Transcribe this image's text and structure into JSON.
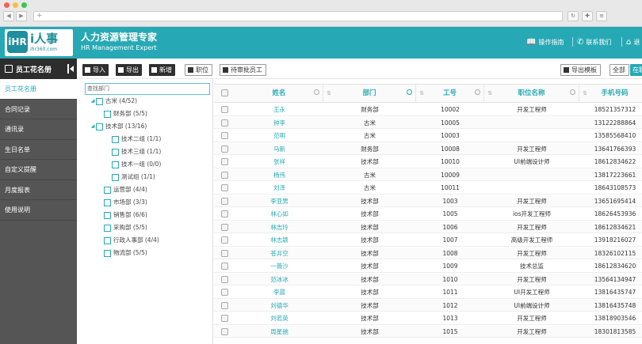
{
  "header": {
    "logo_text": "i人事",
    "logo_sub": "ihr360.com",
    "logo_mark": "iHR",
    "title": "人力资源管理专家",
    "subtitle": "HR Management Expert",
    "links": [
      "操作指南",
      "联系我们",
      "退"
    ]
  },
  "sidebar": {
    "title": "员工花名册",
    "items": [
      {
        "label": "员工花名册",
        "active": true
      },
      {
        "label": "合同记录",
        "active": false
      },
      {
        "label": "通讯录",
        "active": false
      },
      {
        "label": "生日名单",
        "active": false
      },
      {
        "label": "自定义提醒",
        "active": false
      },
      {
        "label": "月度报表",
        "active": false
      },
      {
        "label": "使用说明",
        "active": false
      }
    ]
  },
  "toolbar": {
    "import": "导入",
    "export": "导出",
    "add": "新增",
    "position": "职位",
    "pending": "待审批员工",
    "export_template": "导出模板",
    "all": "全部",
    "current": "在职"
  },
  "tree": {
    "search_placeholder": "查找部门",
    "nodes": [
      {
        "label": "古米 (4/52)",
        "toggle": "◢"
      },
      {
        "label": "财务部 (5/5)",
        "toggle": ""
      },
      {
        "label": "技术部 (13/16)",
        "toggle": "◢"
      },
      {
        "label": "技术二组 (1/1)",
        "toggle": ""
      },
      {
        "label": "技术三组 (1/1)",
        "toggle": ""
      },
      {
        "label": "技术一组 (0/0)",
        "toggle": ""
      },
      {
        "label": "测试组 (1/1)",
        "toggle": ""
      },
      {
        "label": "运营部 (4/4)",
        "toggle": ""
      },
      {
        "label": "市场部 (3/3)",
        "toggle": ""
      },
      {
        "label": "销售部 (6/6)",
        "toggle": ""
      },
      {
        "label": "采购部 (5/5)",
        "toggle": ""
      },
      {
        "label": "行政人事部 (4/4)",
        "toggle": ""
      },
      {
        "label": "物流部 (5/5)",
        "toggle": ""
      }
    ]
  },
  "grid": {
    "columns": [
      "姓名",
      "部门",
      "工号",
      "职位名称",
      "手机号码"
    ],
    "rows": [
      {
        "name": "王永",
        "dept": "财务部",
        "id": "10002",
        "title": "开发工程师",
        "phone": "18521357312"
      },
      {
        "name": "钟李",
        "dept": "古米",
        "id": "10005",
        "title": "",
        "phone": "13122288864"
      },
      {
        "name": "范明",
        "dept": "古米",
        "id": "10003",
        "title": "",
        "phone": "13585568410"
      },
      {
        "name": "马新",
        "dept": "财务部",
        "id": "10008",
        "title": "开发工程师",
        "phone": "13641766393"
      },
      {
        "name": "张祥",
        "dept": "技术部",
        "id": "10010",
        "title": "UI前端设计师",
        "phone": "18612834622"
      },
      {
        "name": "杨伟",
        "dept": "古米",
        "id": "10009",
        "title": "",
        "phone": "13817223661"
      },
      {
        "name": "刘泽",
        "dept": "古米",
        "id": "10011",
        "title": "",
        "phone": "18643108573"
      },
      {
        "name": "李亚男",
        "dept": "技术部",
        "id": "1003",
        "title": "开发工程师",
        "phone": "13651695414"
      },
      {
        "name": "林心如",
        "dept": "技术部",
        "id": "1005",
        "title": "ios开发工程师",
        "phone": "18626453936"
      },
      {
        "name": "林志玲",
        "dept": "技术部",
        "id": "1006",
        "title": "开发工程师",
        "phone": "18612834621"
      },
      {
        "name": "林志颖",
        "dept": "技术部",
        "id": "1007",
        "title": "高级开发工程师",
        "phone": "13918216027"
      },
      {
        "name": "苍井空",
        "dept": "技术部",
        "id": "1008",
        "title": "开发工程师",
        "phone": "18326102115"
      },
      {
        "name": "一薇沙",
        "dept": "技术部",
        "id": "1009",
        "title": "技术总监",
        "phone": "18612834620"
      },
      {
        "name": "范冰冰",
        "dept": "技术部",
        "id": "1010",
        "title": "开发工程师",
        "phone": "13564134947"
      },
      {
        "name": "李晨",
        "dept": "技术部",
        "id": "1011",
        "title": "UI开发工程师",
        "phone": "13816435747"
      },
      {
        "name": "刘德华",
        "dept": "技术部",
        "id": "1012",
        "title": "UI前端设计师",
        "phone": "13816435748"
      },
      {
        "name": "刘若英",
        "dept": "技术部",
        "id": "1013",
        "title": "开发工程师",
        "phone": "13818903546"
      },
      {
        "name": "周星驰",
        "dept": "技术部",
        "id": "1015",
        "title": "开发工程师",
        "phone": "18301813585"
      }
    ]
  },
  "colors": {
    "accent": "#26a9b5",
    "sidebar_bg": "#555555",
    "dark_btn": "#2f2f2f"
  }
}
